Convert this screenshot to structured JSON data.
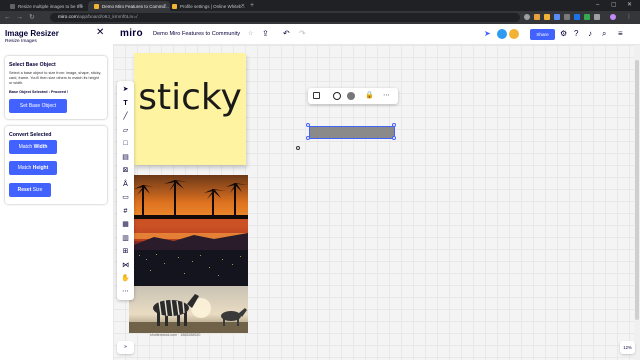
{
  "browser": {
    "tabs": [
      {
        "title": "Resize multiple images to be the",
        "fav_color": "#5f6368",
        "active": false
      },
      {
        "title": "Demo Miro Features to Commu...",
        "fav_color": "#f2b233",
        "active": true
      },
      {
        "title": "Profile settings | Online Whiteb...",
        "fav_color": "#f2b233",
        "active": false
      }
    ],
    "address": {
      "host": "miro.com",
      "path": "/app/board/o9J_kmmf0Lrv=/"
    },
    "colors": {
      "frame": "#202124",
      "toolbar": "#35363a"
    }
  },
  "plugin": {
    "title": "Image Resizer",
    "subtitle": "Resize Images",
    "base_section": {
      "heading": "Select Base Object",
      "description": "Select a base object to size from: image, shape, sticky, card, frame. You'll then size others to match its height or width.",
      "state": "Base Object Selected : Proceed !",
      "set_button": "Set Base Object"
    },
    "convert_section": {
      "heading": "Convert Selected",
      "width_prefix": "Match ",
      "width_bold": "Width",
      "height_prefix": "Match ",
      "height_bold": "Height",
      "reset_bold": "Reset",
      "reset_suffix": " Size"
    },
    "colors": {
      "button": "#4262ff",
      "text": "#050038"
    }
  },
  "miro": {
    "logo": "miro",
    "board_name": "Demo Miro Features to Community",
    "share_label": "Share",
    "zoom": "12%"
  },
  "canvas": {
    "sticky_text": "sticky",
    "sticky_color": "#fdf3a0",
    "watermark": "shutterstock.com · 1865288920",
    "shape_color": "#8a8a8a",
    "selection_color": "#4262ff"
  }
}
